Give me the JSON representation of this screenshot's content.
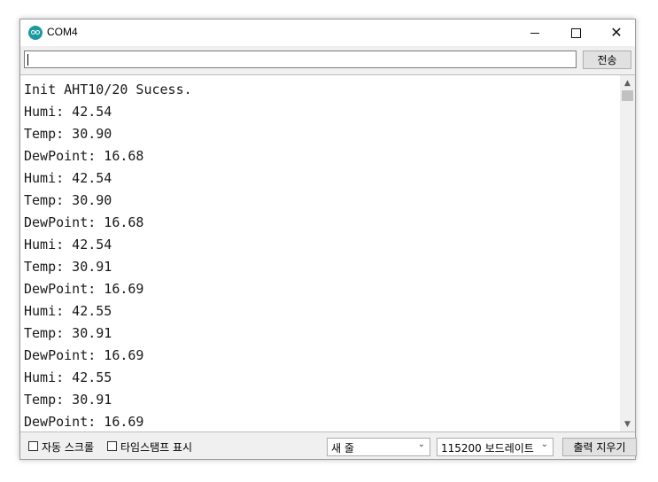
{
  "window": {
    "title": "COM4"
  },
  "send": {
    "input_value": "",
    "send_label": "전송"
  },
  "output_lines": [
    "Init AHT10/20 Sucess.",
    "Humi: 42.54",
    "Temp: 30.90",
    "DewPoint: 16.68",
    "Humi: 42.54",
    "Temp: 30.90",
    "DewPoint: 16.68",
    "Humi: 42.54",
    "Temp: 30.91",
    "DewPoint: 16.69",
    "Humi: 42.55",
    "Temp: 30.91",
    "DewPoint: 16.69",
    "Humi: 42.55",
    "Temp: 30.91",
    "DewPoint: 16.69"
  ],
  "bottom": {
    "autoscroll_label": "자동 스크롤",
    "timestamp_label": "타임스탬프 표시",
    "line_ending": "새 줄",
    "baud_rate": "115200 보드레이트",
    "clear_label": "출력 지우기"
  },
  "icons": {
    "app": "arduino-icon",
    "minimize": "minimize-icon",
    "maximize": "maximize-icon",
    "close": "close-icon"
  },
  "colors": {
    "app_icon": "#1c9aa0"
  }
}
